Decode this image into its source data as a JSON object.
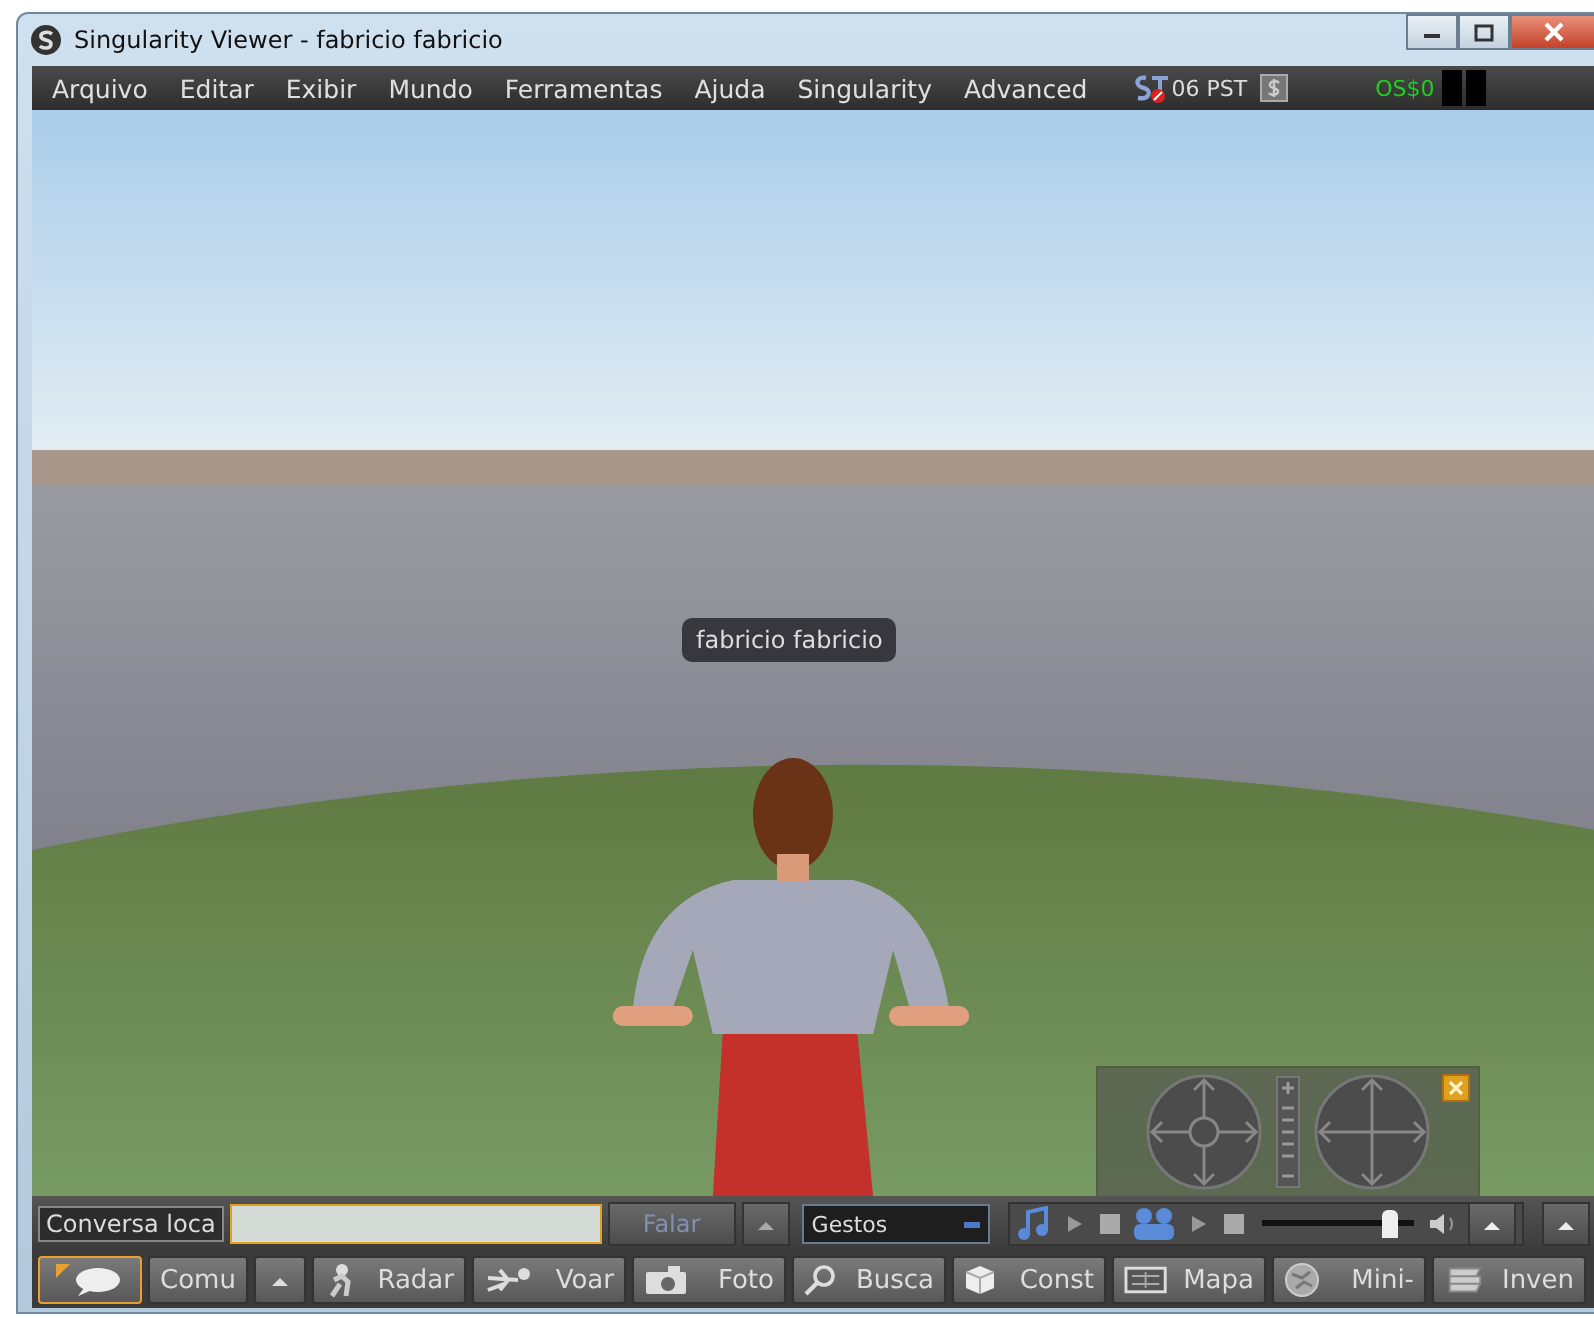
{
  "window": {
    "title": "Singularity Viewer - fabricio fabricio"
  },
  "menu": {
    "items": [
      "Arquivo",
      "Editar",
      "Exibir",
      "Mundo",
      "Ferramentas",
      "Ajuda",
      "Singularity",
      "Advanced"
    ],
    "time": "06 PST",
    "balance": "OS$0"
  },
  "viewport": {
    "name_tag": "fabricio fabricio"
  },
  "chat_bar": {
    "channel": "Conversa loca",
    "speak": {
      "label": "Falar",
      "disabled": true
    },
    "gestures": "Gestos",
    "volume": {
      "level": 0.85
    }
  },
  "toolbar": [
    {
      "selected": true
    },
    {
      "label": "Comu",
      "selected": false
    },
    {
      "label": "Radar",
      "selected": false
    },
    {
      "label": "Voar",
      "selected": false
    },
    {
      "label": "Foto",
      "selected": false
    },
    {
      "label": "Busca",
      "selected": false
    },
    {
      "label": "Const",
      "selected": false
    },
    {
      "label": "Mapa",
      "selected": false
    },
    {
      "label": "Mini-",
      "selected": false
    },
    {
      "label": "Inven",
      "selected": false
    }
  ]
}
